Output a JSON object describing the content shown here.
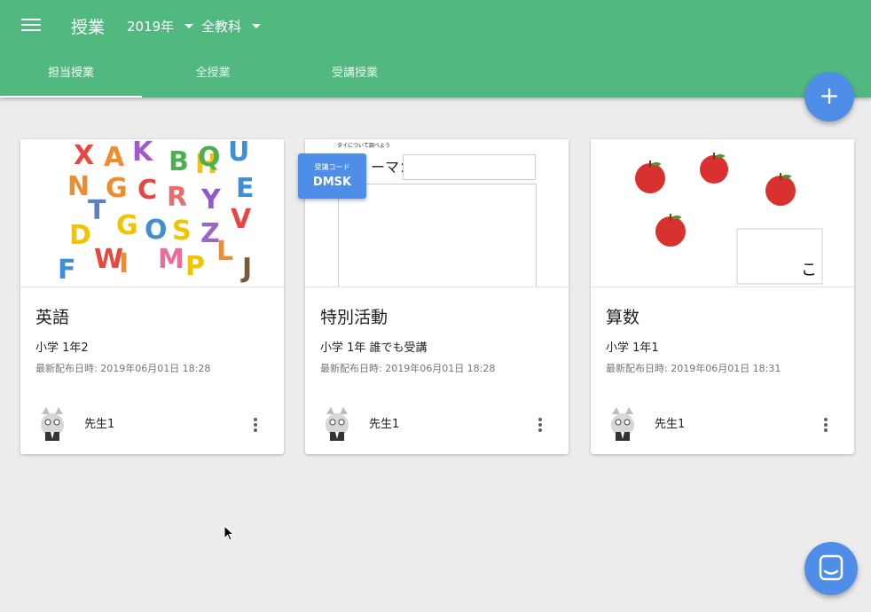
{
  "appbar": {
    "title": "授業",
    "year_select": "2019年",
    "subject_select": "全教科"
  },
  "tabs": [
    {
      "label": "担当授業",
      "active": true
    },
    {
      "label": "全授業",
      "active": false
    },
    {
      "label": "受講授業",
      "active": false
    }
  ],
  "fab_add": {
    "label": "+"
  },
  "cards": [
    {
      "title": "英語",
      "class": "小学 1年2",
      "date": "最新配布日時: 2019年06月01日 18:28",
      "teacher": "先生1",
      "thumb_letters": [
        "X",
        "A",
        "K",
        "B",
        "H",
        "U",
        "N",
        "G",
        "C",
        "R",
        "Y",
        "E",
        "T",
        "G",
        "O",
        "S",
        "Z",
        "V",
        "D",
        "W",
        "I",
        "M",
        "P",
        "L",
        "J",
        "F",
        "Q"
      ]
    },
    {
      "title": "特別活動",
      "class": "小学 1年 誰でも受講",
      "date": "最新配布日時: 2019年06月01日 18:28",
      "teacher": "先生1",
      "thumb_caption": "タイについて調べよう",
      "thumb_label": "ーマ："
    },
    {
      "title": "算数",
      "class": "小学 1年1",
      "date": "最新配布日時: 2019年06月01日 18:31",
      "teacher": "先生1",
      "thumb_char": "こ"
    }
  ],
  "code_badge": {
    "label": "受講コード",
    "value": "DMSK"
  },
  "colors": {
    "primary": "#51b97f",
    "accent": "#4f8ee8",
    "background": "#ececec"
  }
}
